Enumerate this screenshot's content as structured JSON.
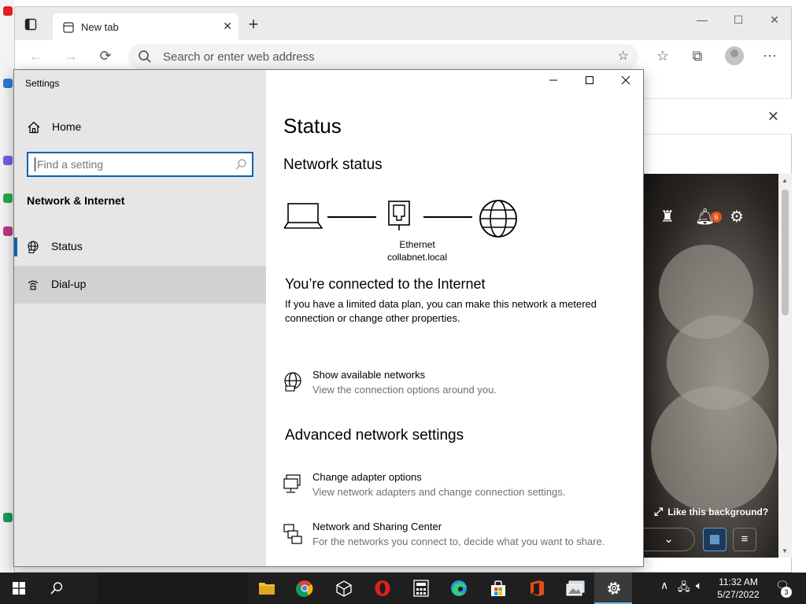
{
  "browser": {
    "tab_title": "New tab",
    "address_placeholder": "Search or enter web address",
    "ntp_notification_count": "6",
    "like_background": "Like this background?"
  },
  "settings": {
    "app_title": "Settings",
    "home_label": "Home",
    "search_placeholder": "Find a setting",
    "section_title": "Network & Internet",
    "nav": [
      {
        "label": "Status",
        "icon": "globe-icon"
      },
      {
        "label": "Dial-up",
        "icon": "dialup-icon"
      }
    ],
    "page_title": "Status",
    "network_status_heading": "Network status",
    "adapter_name": "Ethernet",
    "network_name": "collabnet.local",
    "connected_heading": "You’re connected to the Internet",
    "connected_desc": "If you have a limited data plan, you can make this network a metered connection or change other properties.",
    "show_networks": {
      "title": "Show available networks",
      "subtitle": "View the connection options around you."
    },
    "advanced_heading": "Advanced network settings",
    "change_adapter": {
      "title": "Change adapter options",
      "subtitle": "View network adapters and change connection settings."
    },
    "sharing_center": {
      "title": "Network and Sharing Center",
      "subtitle": "For the networks you connect to, decide what you want to share."
    }
  },
  "taskbar": {
    "time": "11:32 AM",
    "date": "5/27/2022",
    "notifications": "3",
    "apps": [
      "file-explorer",
      "chrome",
      "3d-viewer",
      "opera",
      "calculator",
      "edge",
      "microsoft-store",
      "office",
      "photos",
      "settings"
    ]
  },
  "colors": {
    "accent": "#0063b1",
    "sidebar_bg": "#e6e6e6",
    "taskbar_bg": "#1f1f1f"
  }
}
